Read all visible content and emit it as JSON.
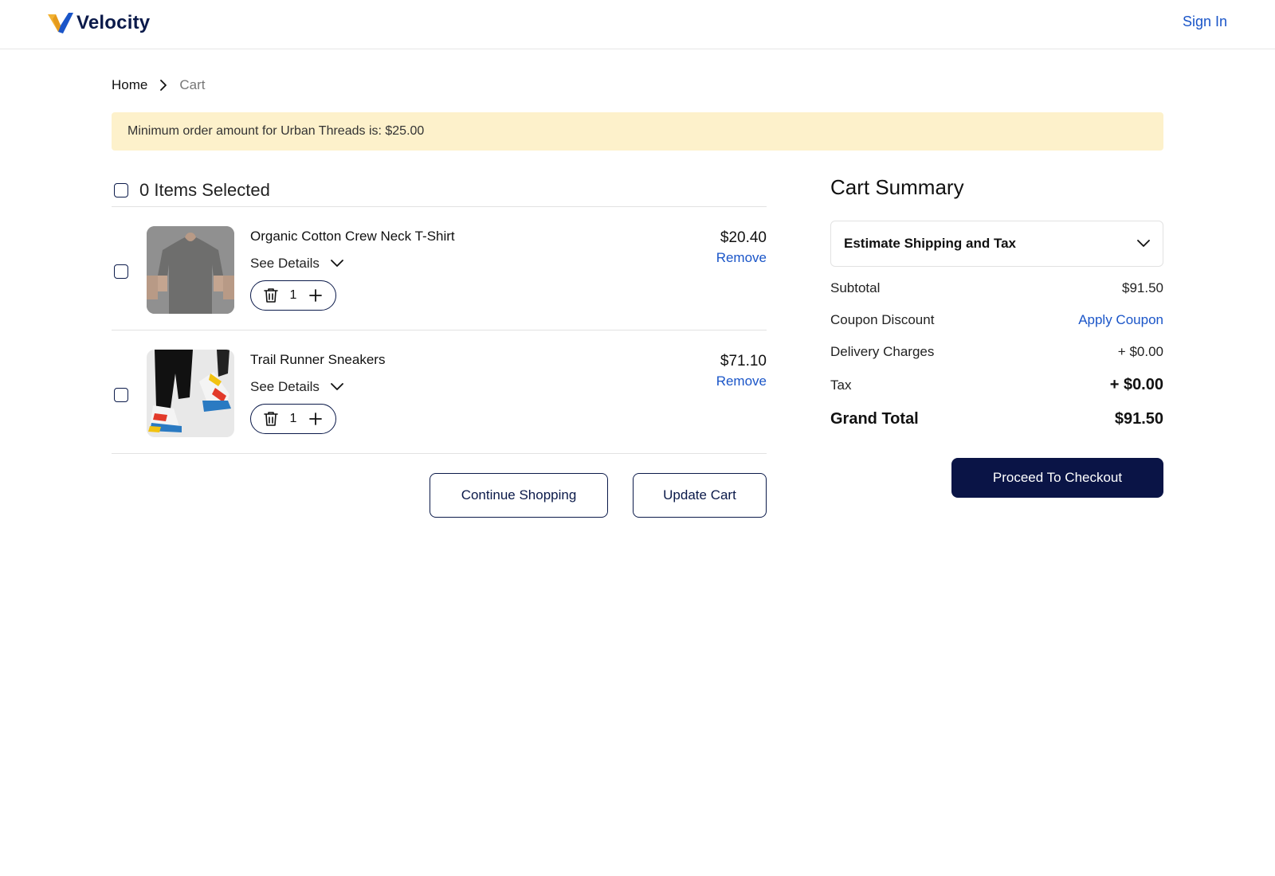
{
  "header": {
    "logo_text": "Velocity",
    "sign_in": "Sign In"
  },
  "breadcrumb": {
    "home": "Home",
    "current": "Cart"
  },
  "banner": {
    "text": "Minimum order amount for Urban Threads is: $25.00"
  },
  "cart": {
    "selected_label": "0 Items Selected",
    "items": [
      {
        "name": "Organic Cotton Crew Neck T-Shirt",
        "see_details": "See Details",
        "quantity": "1",
        "price": "$20.40",
        "remove": "Remove",
        "image": "gray-tshirt-photo"
      },
      {
        "name": "Trail Runner Sneakers",
        "see_details": "See Details",
        "quantity": "1",
        "price": "$71.10",
        "remove": "Remove",
        "image": "sneakers-photo"
      }
    ],
    "continue_shopping": "Continue Shopping",
    "update_cart": "Update Cart"
  },
  "summary": {
    "title": "Cart Summary",
    "estimate_label": "Estimate Shipping and Tax",
    "subtotal_label": "Subtotal",
    "subtotal_value": "$91.50",
    "coupon_label": "Coupon Discount",
    "coupon_action": "Apply Coupon",
    "delivery_label": "Delivery Charges",
    "delivery_value": "+ $0.00",
    "tax_label": "Tax",
    "tax_value": "+ $0.00",
    "grand_total_label": "Grand Total",
    "grand_total_value": "$91.50",
    "checkout": "Proceed To Checkout"
  },
  "colors": {
    "brand_navy": "#0a1446",
    "link_blue": "#1a55c8",
    "banner_bg": "#fdf1cb",
    "logo_gold": "#f2b233"
  }
}
